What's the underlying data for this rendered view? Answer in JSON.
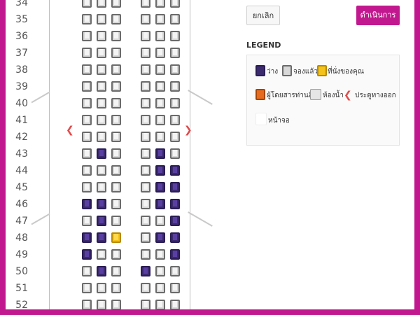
{
  "buttons": {
    "cancel": "ยกเลิก",
    "proceed": "ดำเนินการ"
  },
  "legend": {
    "title": "LEGEND",
    "items": [
      {
        "icon": "available-seat-icon",
        "label": "ว่าง"
      },
      {
        "icon": "booked-seat-icon",
        "label": "จองแล้ว"
      },
      {
        "icon": "your-seat-icon",
        "label": "ที่นั่งของคุณ"
      },
      {
        "icon": "other-passenger-seat-icon",
        "label": "ผู้โดยสารท่านอื่น"
      },
      {
        "icon": "toilet-icon",
        "label": "ห้องน้ำ"
      },
      {
        "icon": "exit-door-icon",
        "label": "ประตูทางออก"
      },
      {
        "icon": "screen-icon",
        "label": "หน้าจอ"
      }
    ]
  },
  "colors": {
    "brand": "#c2188f",
    "available": "#3b2a6e",
    "booked": "#d8d8d8",
    "mine": "#f4c21a",
    "other": "#e66a1f",
    "exit": "#e24a4a"
  },
  "seat_rows": [
    {
      "num": "34",
      "seats": [
        "b",
        "b",
        "b",
        "b",
        "b",
        "b"
      ]
    },
    {
      "num": "35",
      "seats": [
        "b",
        "b",
        "b",
        "b",
        "b",
        "b"
      ]
    },
    {
      "num": "36",
      "seats": [
        "b",
        "b",
        "b",
        "b",
        "b",
        "b"
      ]
    },
    {
      "num": "37",
      "seats": [
        "b",
        "b",
        "b",
        "b",
        "b",
        "b"
      ]
    },
    {
      "num": "38",
      "seats": [
        "b",
        "b",
        "b",
        "b",
        "b",
        "b"
      ]
    },
    {
      "num": "39",
      "seats": [
        "b",
        "b",
        "b",
        "b",
        "b",
        "b"
      ]
    },
    {
      "num": "40",
      "seats": [
        "b",
        "b",
        "b",
        "b",
        "b",
        "b"
      ]
    },
    {
      "num": "41",
      "seats": [
        "b",
        "b",
        "b",
        "b",
        "b",
        "b"
      ]
    },
    {
      "num": "42",
      "seats": [
        "b",
        "b",
        "b",
        "b",
        "b",
        "b"
      ],
      "exit": true
    },
    {
      "num": "43",
      "seats": [
        "b",
        "a",
        "b",
        "b",
        "a",
        "b"
      ]
    },
    {
      "num": "44",
      "seats": [
        "b",
        "b",
        "b",
        "b",
        "a",
        "a"
      ]
    },
    {
      "num": "45",
      "seats": [
        "b",
        "b",
        "b",
        "b",
        "a",
        "a"
      ]
    },
    {
      "num": "46",
      "seats": [
        "a",
        "a",
        "b",
        "b",
        "a",
        "a"
      ]
    },
    {
      "num": "47",
      "seats": [
        "b",
        "a",
        "b",
        "b",
        "b",
        "a"
      ]
    },
    {
      "num": "48",
      "seats": [
        "a",
        "a",
        "m",
        "b",
        "a",
        "a"
      ]
    },
    {
      "num": "49",
      "seats": [
        "a",
        "b",
        "b",
        "b",
        "b",
        "a"
      ]
    },
    {
      "num": "50",
      "seats": [
        "b",
        "a",
        "b",
        "a",
        "b",
        "b"
      ]
    },
    {
      "num": "51",
      "seats": [
        "b",
        "b",
        "b",
        "b",
        "b",
        "b"
      ]
    },
    {
      "num": "52",
      "seats": [
        "b",
        "b",
        "b",
        "b",
        "b",
        "b"
      ]
    }
  ]
}
